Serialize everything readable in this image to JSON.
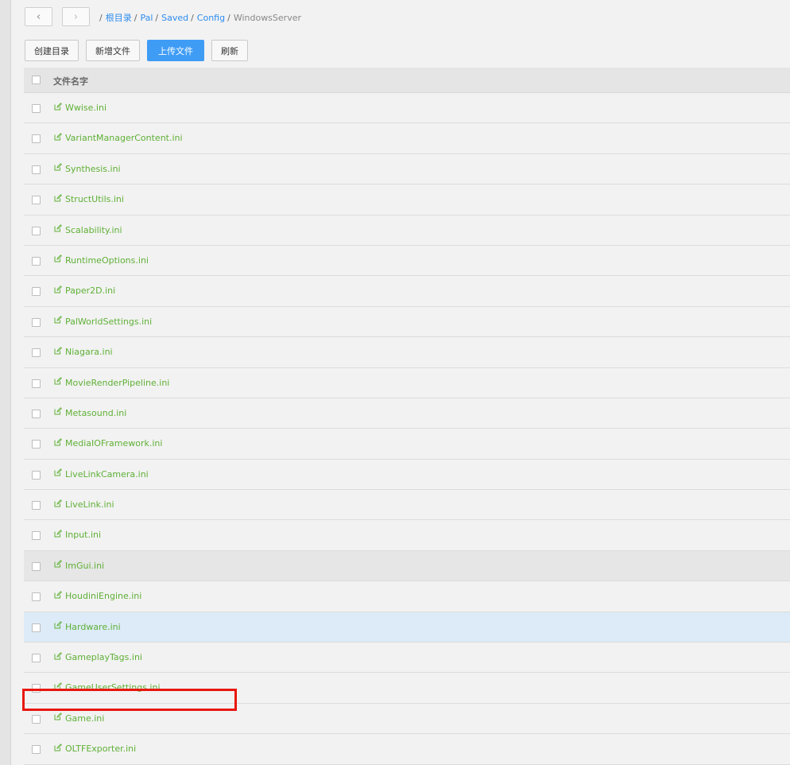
{
  "nav": {
    "back_symbol": "‹",
    "forward_symbol": "›"
  },
  "breadcrumb": [
    {
      "label": "根目录",
      "current": false
    },
    {
      "label": "Pal",
      "current": false
    },
    {
      "label": "Saved",
      "current": false
    },
    {
      "label": "Config",
      "current": false
    },
    {
      "label": "WindowsServer",
      "current": true
    }
  ],
  "toolbar": {
    "create_dir": "创建目录",
    "new_file": "新增文件",
    "upload": "上传文件",
    "refresh": "刷新"
  },
  "table": {
    "header": "文件名字",
    "rows": [
      {
        "name": "Wwise.ini",
        "state": ""
      },
      {
        "name": "VariantManagerContent.ini",
        "state": ""
      },
      {
        "name": "Synthesis.ini",
        "state": ""
      },
      {
        "name": "StructUtils.ini",
        "state": ""
      },
      {
        "name": "Scalability.ini",
        "state": ""
      },
      {
        "name": "RuntimeOptions.ini",
        "state": ""
      },
      {
        "name": "Paper2D.ini",
        "state": ""
      },
      {
        "name": "PalWorldSettings.ini",
        "state": ""
      },
      {
        "name": "Niagara.ini",
        "state": ""
      },
      {
        "name": "MovieRenderPipeline.ini",
        "state": ""
      },
      {
        "name": "Metasound.ini",
        "state": ""
      },
      {
        "name": "MediaIOFramework.ini",
        "state": ""
      },
      {
        "name": "LiveLinkCamera.ini",
        "state": ""
      },
      {
        "name": "LiveLink.ini",
        "state": ""
      },
      {
        "name": "Input.ini",
        "state": ""
      },
      {
        "name": "ImGui.ini",
        "state": "hover"
      },
      {
        "name": "HoudiniEngine.ini",
        "state": ""
      },
      {
        "name": "Hardware.ini",
        "state": "selected"
      },
      {
        "name": "GameplayTags.ini",
        "state": ""
      },
      {
        "name": "GameUserSettings.ini",
        "state": ""
      },
      {
        "name": "Game.ini",
        "state": ""
      },
      {
        "name": "OLTFExporter.ini",
        "state": ""
      }
    ]
  },
  "colors": {
    "link": "#5fb036",
    "primary": "#3f9cf5",
    "highlight": "#e8170f"
  },
  "icons": {
    "row_icon": "edit-icon"
  }
}
